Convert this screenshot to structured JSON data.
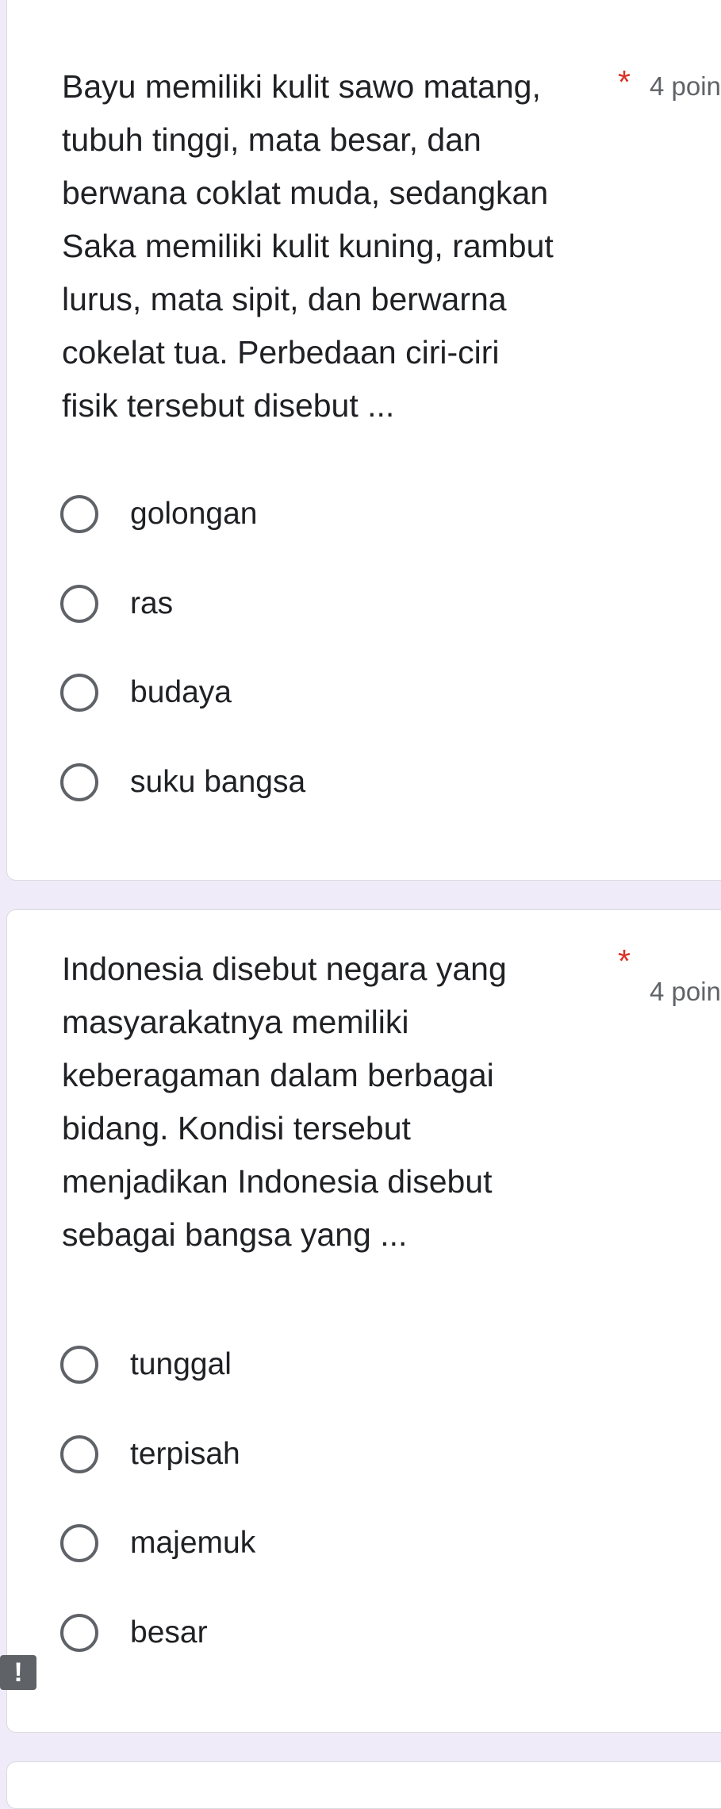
{
  "questions": [
    {
      "text": "Bayu memiliki kulit sawo matang,\ntubuh tinggi, mata besar, dan\nberwana coklat muda, sedangkan\nSaka memiliki kulit kuning, rambut\nlurus, mata sipit, dan berwarna\ncokelat tua. Perbedaan ciri-ciri\nfisik tersebut disebut ...",
      "required_mark": "*",
      "points": "4 poin",
      "options": [
        "golongan",
        "ras",
        "budaya",
        "suku bangsa"
      ]
    },
    {
      "text": "Indonesia disebut negara yang\nmasyarakatnya memiliki\nkeberagaman dalam berbagai\nbidang. Kondisi tersebut\nmenjadikan Indonesia disebut\nsebagai bangsa yang ...",
      "required_mark": "*",
      "points": "4 poin",
      "options": [
        "tunggal",
        "terpisah",
        "majemuk",
        "besar"
      ]
    }
  ],
  "alert_icon": "!",
  "colors": {
    "background": "#f0ebf8",
    "card": "#ffffff",
    "required": "#d93025",
    "secondary_text": "#5f6368",
    "radio_border": "#5f6368"
  }
}
